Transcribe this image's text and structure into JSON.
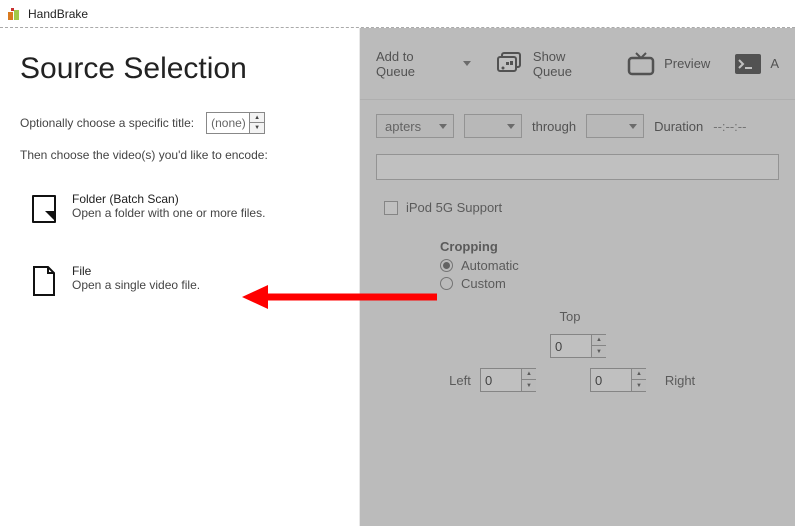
{
  "app": {
    "title": "HandBrake"
  },
  "sidebar": {
    "heading": "Source Selection",
    "opt_title_label": "Optionally choose a specific title:",
    "opt_title_value": "(none)",
    "instruction": "Then choose the video(s) you'd like to encode:",
    "items": [
      {
        "title": "Folder (Batch Scan)",
        "desc": "Open a folder with one or more files."
      },
      {
        "title": "File",
        "desc": "Open a single video file."
      }
    ]
  },
  "toolbar": {
    "add_queue": "Add to Queue",
    "show_queue": "Show Queue",
    "preview": "Preview",
    "activity": "A"
  },
  "chapters": {
    "label": "apters",
    "through": "through",
    "duration_label": "Duration",
    "duration_value": "--:--:--"
  },
  "ipod": {
    "label": "iPod 5G Support"
  },
  "cropping": {
    "title": "Cropping",
    "auto": "Automatic",
    "custom": "Custom",
    "top": "Top",
    "left": "Left",
    "right": "Right",
    "top_value": "0",
    "left_value": "0",
    "right_value": "0"
  }
}
